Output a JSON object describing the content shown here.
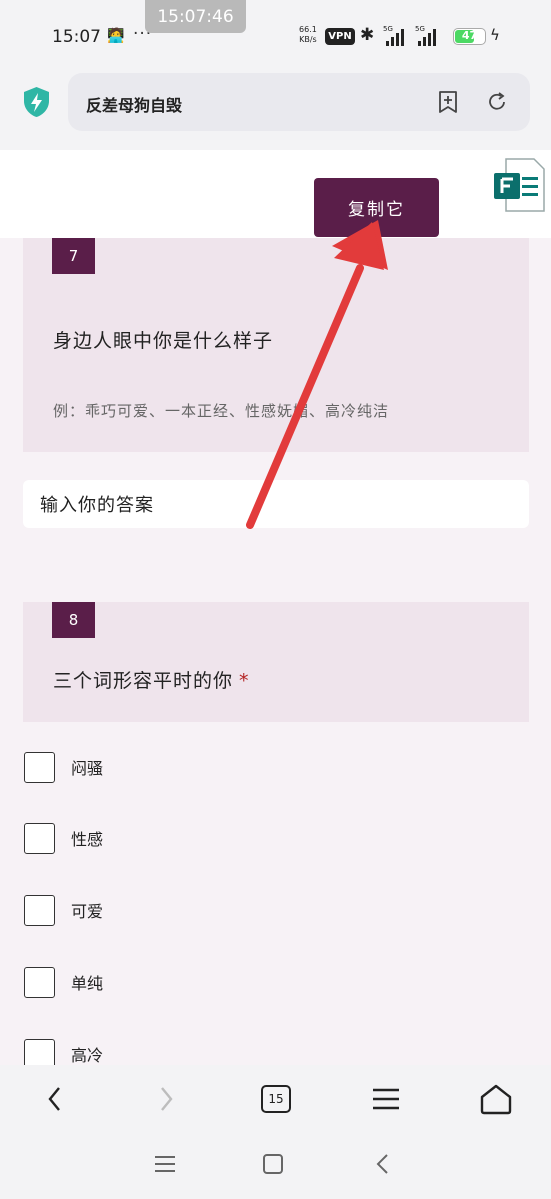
{
  "status": {
    "time": "15:07",
    "dots": "···",
    "overlay_time": "15:07:46",
    "net_speed_value": "66.1",
    "net_speed_unit": "KB/s",
    "vpn": "VPN",
    "signal1_tag": "5G",
    "signal2_tag": "5G",
    "battery": "47"
  },
  "browser": {
    "address": "反差母狗自毁"
  },
  "page": {
    "copy_button": "复制它",
    "questions": [
      {
        "number": "7",
        "title": "身边人眼中你是什么样子",
        "description": "例：乖巧可爱、一本正经、性感妩媚、高冷纯洁"
      },
      {
        "number": "8",
        "title": "三个词形容平时的你",
        "required": "*"
      }
    ],
    "answer_placeholder": "输入你的答案",
    "options": [
      "闷骚",
      "性感",
      "可爱",
      "单纯",
      "高冷"
    ]
  },
  "nav": {
    "tab_count": "15"
  },
  "colors": {
    "accent": "#5a1e49",
    "card_bg": "#efe4ec",
    "arrow": "#e23b3b"
  }
}
